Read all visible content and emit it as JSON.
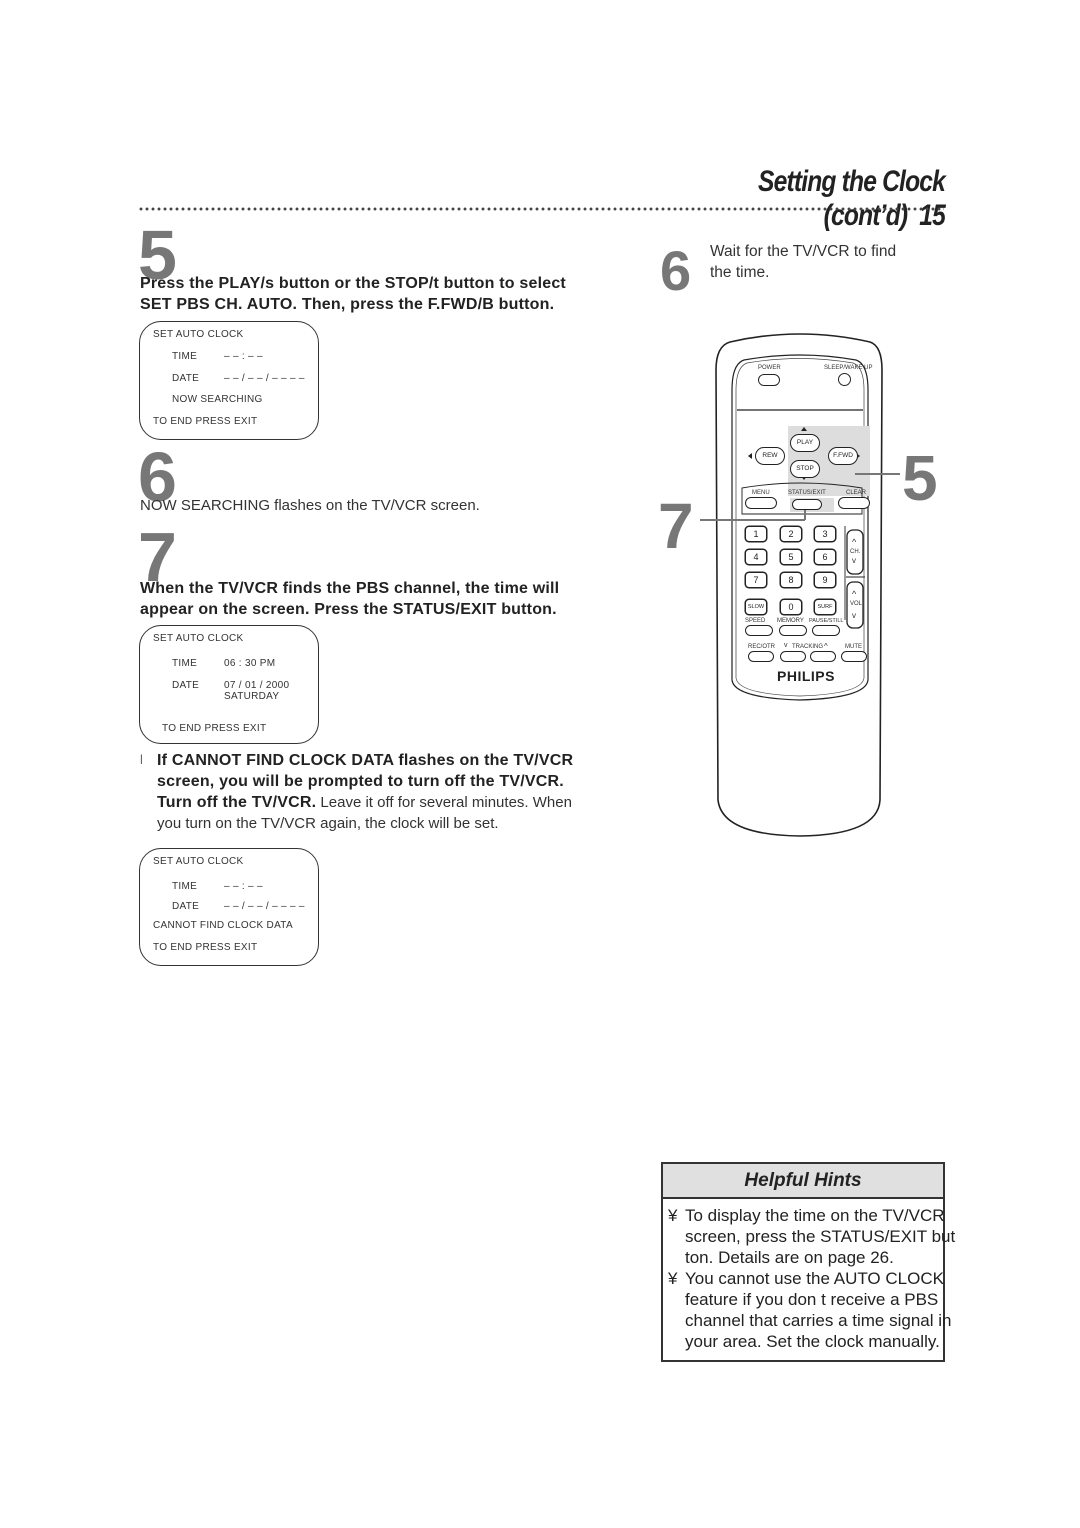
{
  "header": {
    "title": "Setting the Clock (cont’d)",
    "page_number": "15"
  },
  "left": {
    "step5": {
      "number": "5",
      "instruction_line1": "Press the PLAY/s  button or the STOP/t  button to select",
      "instruction_line2": "SET PBS CH. AUTO. Then, press the F.FWD/B  button.",
      "osd": {
        "title": "SET AUTO CLOCK",
        "time_label": "TIME",
        "time_value": "– – : – –",
        "date_label": "DATE",
        "date_value": "– – / – – / – – – –",
        "status": "NOW SEARCHING",
        "footer": "TO END PRESS EXIT"
      }
    },
    "step6": {
      "number": "6",
      "text": "NOW SEARCHING flashes on the TV/VCR screen."
    },
    "step7": {
      "number": "7",
      "instruction_line1": "When the TV/VCR finds the PBS channel, the time will",
      "instruction_line2": "appear on the screen. Press the STATUS/EXIT button.",
      "osd": {
        "title": "SET AUTO CLOCK",
        "time_label": "TIME",
        "time_value": "06 : 30 PM",
        "date_label": "DATE",
        "date_value": "07 / 01 / 2000",
        "day_value": "SATURDAY",
        "footer": "TO END PRESS EXIT"
      }
    },
    "note": {
      "bullet": "l",
      "bold_line1": "If CANNOT FIND CLOCK DATA flashes on the TV/VCR",
      "bold_line2": "screen, you will be prompted to turn off the TV/VCR.",
      "bold_line3": "Turn off the TV/VCR.",
      "normal_line3": " Leave it off for several minutes. When",
      "normal_line4": "you turn on the TV/VCR again, the clock will be set.",
      "osd": {
        "title": "SET AUTO CLOCK",
        "time_label": "TIME",
        "time_value": "– – : – –",
        "date_label": "DATE",
        "date_value": "– – / – – / – – – –",
        "status": "CANNOT FIND CLOCK DATA",
        "footer": "TO END PRESS EXIT"
      }
    }
  },
  "right": {
    "step6": {
      "number": "6",
      "line1": "Wait for the TV/VCR to find",
      "line2": "the time."
    },
    "callouts": {
      "left": "7",
      "right": "5"
    },
    "remote": {
      "brand": "PHILIPS",
      "power": "POWER",
      "sleep": "SLEEP/WAKE UP",
      "play": "PLAY",
      "rew": "REW",
      "ffwd": "F.FWD",
      "stop": "STOP",
      "menu": "MENU",
      "status_exit": "STATUS/EXIT",
      "clear": "CLEAR",
      "keys": [
        "1",
        "2",
        "3",
        "4",
        "5",
        "6",
        "7",
        "8",
        "9"
      ],
      "slow": "SLOW",
      "zero": "0",
      "surf": "SURF",
      "ch": "CH.",
      "vol": "VOL.",
      "speed": "SPEED",
      "memory": "MEMORY",
      "pause_still": "PAUSE/STILL",
      "rec_otr": "REC/OTR",
      "tracking": "TRACKING",
      "mute": "MUTE"
    }
  },
  "hints": {
    "title": "Helpful Hints",
    "bullet": "¥",
    "hint1": [
      "To display the time on the TV/VCR",
      "screen, press the STATUS/EXIT but",
      "ton. Details are on page 26."
    ],
    "hint2": [
      "You cannot use the AUTO CLOCK",
      "feature if you don t receive a PBS",
      "channel that carries a time signal in",
      "your area. Set the clock manually."
    ]
  }
}
